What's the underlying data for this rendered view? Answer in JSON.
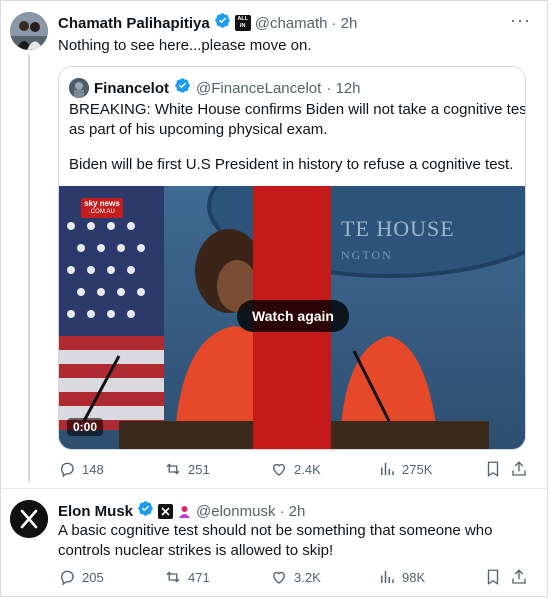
{
  "tweet1": {
    "author_name": "Chamath Palihapitiya",
    "badge_text": "ALL IN",
    "handle": "@chamath",
    "time": "· 2h",
    "text": "Nothing to see here...please move on.",
    "quote": {
      "author_name": "Financelot",
      "handle": "@FinanceLancelot",
      "time": "· 12h",
      "text_line1": "BREAKING: White House confirms Biden will not take a cognitive test",
      "text_line2": "as part of his upcoming physical exam.",
      "text_line3": "Biden will be first U.S President in history to refuse a cognitive test.",
      "video": {
        "channel_logo_line1": "sky news",
        "channel_logo_line2": ".COM.AU",
        "backdrop_text_line1": "TE HOUSE",
        "backdrop_text_line2": "NGTON",
        "watch_again_label": "Watch again",
        "timestamp": "0:00"
      }
    },
    "stats": {
      "replies": "148",
      "reposts": "251",
      "likes": "2.4K",
      "views": "275K"
    }
  },
  "tweet2": {
    "author_name": "Elon Musk",
    "handle": "@elonmusk",
    "time": "· 2h",
    "text_line1": "A basic cognitive test should not be something that someone who",
    "text_line2": "controls nuclear strikes is allowed to skip!",
    "stats": {
      "replies": "205",
      "reposts": "471",
      "likes": "3.2K",
      "views": "98K"
    }
  },
  "colors": {
    "verified_blue": "#1d9bf0",
    "muted_text": "#536471",
    "red_bar": "#c41a1a",
    "pink_badge": "#e0245e"
  },
  "icons": [
    "more-icon",
    "verified-icon",
    "reply-icon",
    "repost-icon",
    "like-icon",
    "views-icon",
    "bookmark-icon",
    "share-icon",
    "x-logo-icon"
  ]
}
